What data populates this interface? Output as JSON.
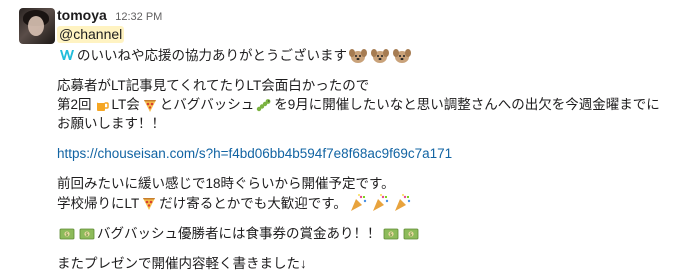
{
  "message": {
    "username": "tomoya",
    "timestamp": "12:32 PM",
    "mention": "@channel",
    "line1_text": "のいいねや応援の協力ありがとうございます",
    "line2": "応募者がLT記事見てくれてたりLT会面白かったので",
    "line3_a": "第2回",
    "line3_b": "LT会",
    "line3_c": "とバグバッシュ",
    "line3_d": "を9月に開催したいなと思い調整さんへの出欠を今週金曜までに",
    "line4": "お願いします！！",
    "link": "https://chouseisan.com/s?h=f4bd06bb4b594f7e8f68ac9f69c7a171",
    "line6": "前回みたいに緩い感じで18時ぐらいから開催予定です。",
    "line7_a": "学校帰りにLT",
    "line7_b": "だけ寄るとかでも大歓迎です。",
    "line8": "バグバッシュ優勝者には食事券の賞金あり！！",
    "line9": "またプレゼンで開催内容軽く書きました↓"
  },
  "icons": {
    "wantedly": "wantedly-logo-icon",
    "dog": "dog-emoji-icon",
    "beer": "beer-emoji-icon",
    "pizza": "pizza-emoji-icon",
    "bug": "bug-emoji-icon",
    "party": "party-popper-emoji-icon",
    "money": "money-bill-emoji-icon"
  },
  "colors": {
    "link": "#1264a3",
    "mention_bg": "#fff3c2",
    "text": "#1d1c1d",
    "timestamp": "#616061"
  }
}
